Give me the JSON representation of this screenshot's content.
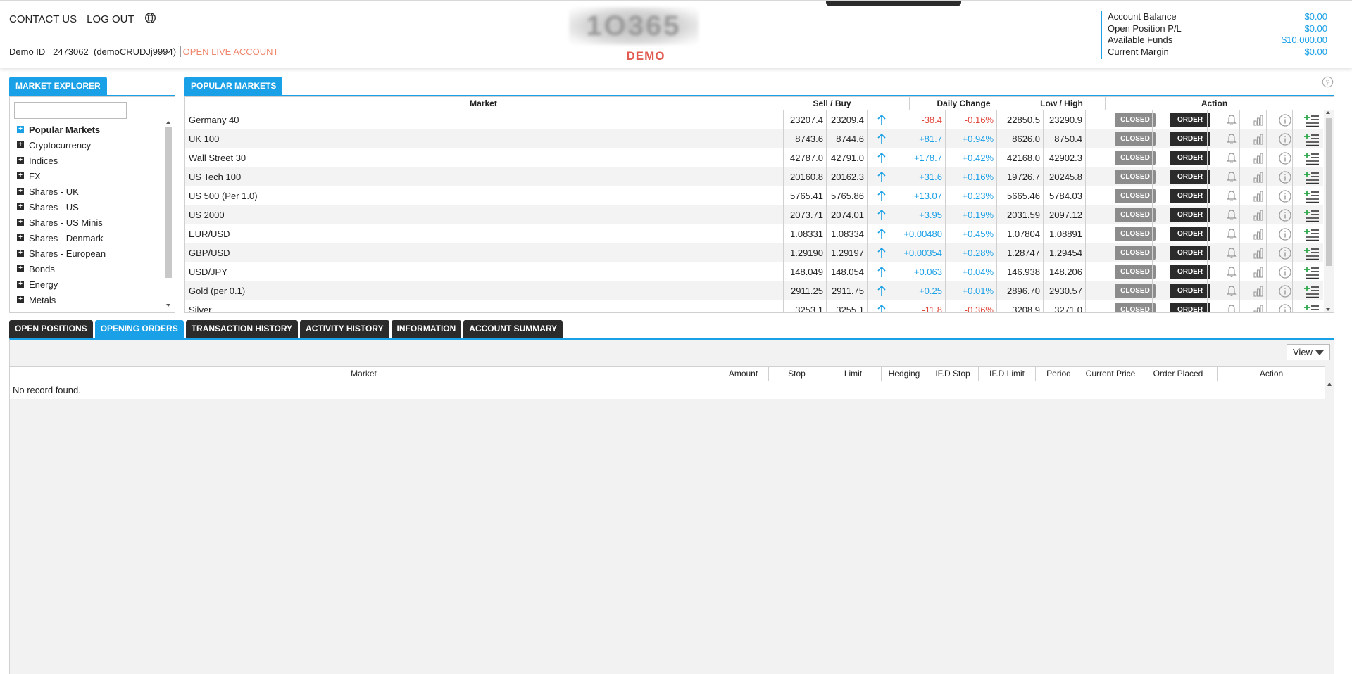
{
  "header": {
    "contact_label": "CONTACT US",
    "logout_label": "LOG OUT",
    "demo_id_label": "Demo ID",
    "demo_id_value": "2473062",
    "username": "(demoCRUDJj9994)",
    "open_live_label": "OPEN LIVE ACCOUNT",
    "logo_text": "1O365",
    "demo_badge": "DEMO"
  },
  "account": {
    "rows": [
      {
        "label": "Account Balance",
        "value": "$0.00"
      },
      {
        "label": "Open Position P/L",
        "value": "$0.00"
      },
      {
        "label": "Available Funds",
        "value": "$10,000.00"
      },
      {
        "label": "Current Margin",
        "value": "$0.00"
      }
    ]
  },
  "explorer": {
    "tab_label": "MARKET EXPLORER",
    "search_value": "",
    "items": [
      "Popular Markets",
      "Cryptocurrency",
      "Indices",
      "FX",
      "Shares - UK",
      "Shares - US",
      "Shares - US Minis",
      "Shares - Denmark",
      "Shares - European",
      "Bonds",
      "Energy",
      "Metals"
    ]
  },
  "markets": {
    "tab_label": "POPULAR MARKETS",
    "headers": {
      "market": "Market",
      "sell_buy": "Sell / Buy",
      "daily_change": "Daily Change",
      "low_high": "Low / High",
      "action": "Action"
    },
    "closed_label": "CLOSED",
    "order_label": "ORDER",
    "rows": [
      {
        "name": "Germany 40",
        "sell": "23207.4",
        "buy": "23209.4",
        "change": "-38.4",
        "pct": "-0.16%",
        "low": "22850.5",
        "high": "23290.9",
        "dir": "neg"
      },
      {
        "name": "UK 100",
        "sell": "8743.6",
        "buy": "8744.6",
        "change": "+81.7",
        "pct": "+0.94%",
        "low": "8626.0",
        "high": "8750.4",
        "dir": "pos"
      },
      {
        "name": "Wall Street 30",
        "sell": "42787.0",
        "buy": "42791.0",
        "change": "+178.7",
        "pct": "+0.42%",
        "low": "42168.0",
        "high": "42902.3",
        "dir": "pos"
      },
      {
        "name": "US Tech 100",
        "sell": "20160.8",
        "buy": "20162.3",
        "change": "+31.6",
        "pct": "+0.16%",
        "low": "19726.7",
        "high": "20245.8",
        "dir": "pos"
      },
      {
        "name": "US 500 (Per 1.0)",
        "sell": "5765.41",
        "buy": "5765.86",
        "change": "+13.07",
        "pct": "+0.23%",
        "low": "5665.46",
        "high": "5784.03",
        "dir": "pos"
      },
      {
        "name": "US 2000",
        "sell": "2073.71",
        "buy": "2074.01",
        "change": "+3.95",
        "pct": "+0.19%",
        "low": "2031.59",
        "high": "2097.12",
        "dir": "pos"
      },
      {
        "name": "EUR/USD",
        "sell": "1.08331",
        "buy": "1.08334",
        "change": "+0.00480",
        "pct": "+0.45%",
        "low": "1.07804",
        "high": "1.08891",
        "dir": "pos"
      },
      {
        "name": "GBP/USD",
        "sell": "1.29190",
        "buy": "1.29197",
        "change": "+0.00354",
        "pct": "+0.28%",
        "low": "1.28747",
        "high": "1.29454",
        "dir": "pos"
      },
      {
        "name": "USD/JPY",
        "sell": "148.049",
        "buy": "148.054",
        "change": "+0.063",
        "pct": "+0.04%",
        "low": "146.938",
        "high": "148.206",
        "dir": "pos"
      },
      {
        "name": "Gold (per 0.1)",
        "sell": "2911.25",
        "buy": "2911.75",
        "change": "+0.25",
        "pct": "+0.01%",
        "low": "2896.70",
        "high": "2930.57",
        "dir": "pos"
      },
      {
        "name": "Silver",
        "sell": "3253.1",
        "buy": "3255.1",
        "change": "-11.8",
        "pct": "-0.36%",
        "low": "3208.9",
        "high": "3271.0",
        "dir": "neg"
      }
    ]
  },
  "bottom": {
    "tabs": [
      "OPEN POSITIONS",
      "OPENING ORDERS",
      "TRANSACTION HISTORY",
      "ACTIVITY HISTORY",
      "INFORMATION",
      "ACCOUNT SUMMARY"
    ],
    "active_tab": 1,
    "view_label": "View",
    "headers": [
      "Market",
      "Amount",
      "Stop",
      "Limit",
      "Hedging",
      "IF.D Stop",
      "IF.D Limit",
      "Period",
      "Current Price",
      "Order Placed",
      "Action"
    ],
    "empty_message": "No record found."
  },
  "colors": {
    "accent": "#1aa0e6",
    "positive": "#1aa0e6",
    "negative": "#e0453a",
    "demo": "#e05a4f",
    "dark_button": "#2b2b2b",
    "closed_button": "#8c8c8c"
  },
  "icons": [
    "globe-icon",
    "help-icon",
    "up-arrow-icon",
    "bell-icon",
    "chart-icon",
    "info-icon",
    "add-watchlist-icon"
  ]
}
